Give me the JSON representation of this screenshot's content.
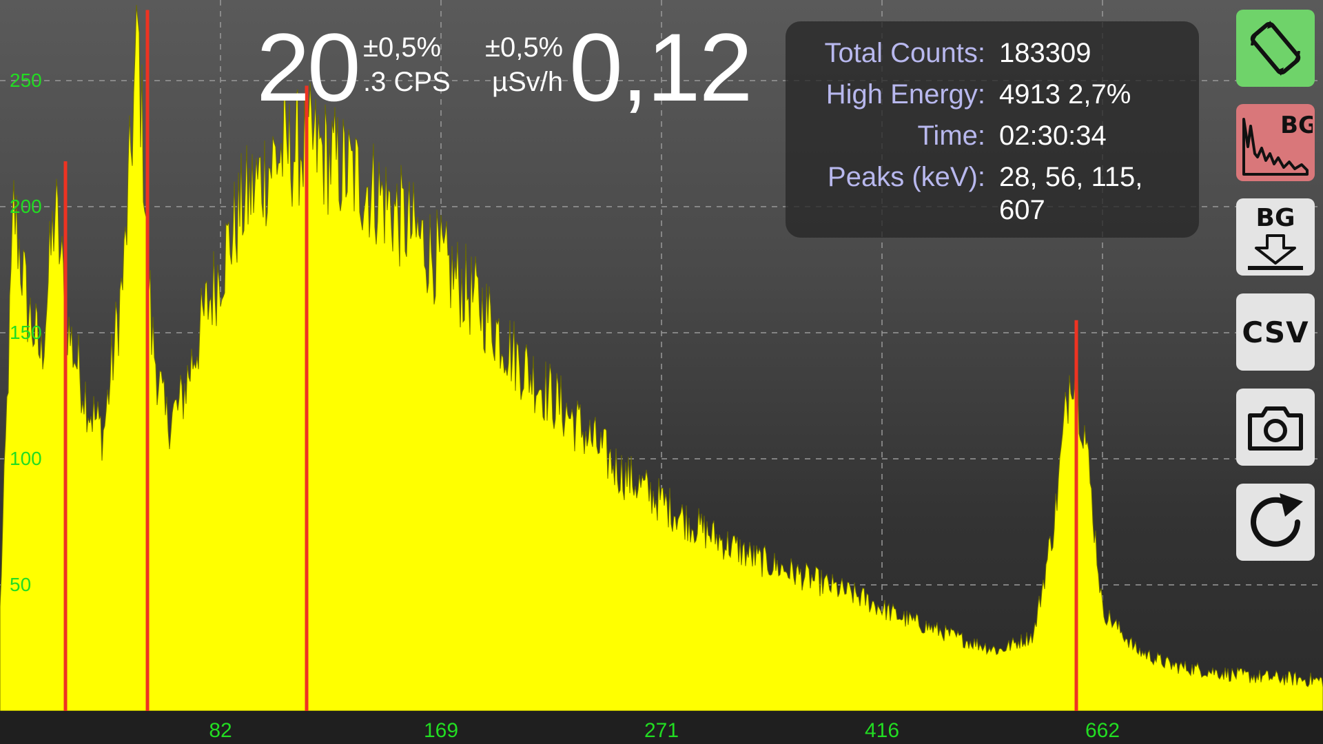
{
  "readings": {
    "cps_int": "20",
    "cps_error": "±0,5%",
    "cps_unit": ".3 CPS",
    "dose_error": "±0,5%",
    "dose_unit": "µSv/h",
    "dose_value": "0,12"
  },
  "info": {
    "total_counts_label": "Total Counts:",
    "total_counts_value": "183309",
    "high_energy_label": "High Energy:",
    "high_energy_value": "4913 2,7%",
    "time_label": "Time:",
    "time_value": "02:30:34",
    "peaks_label": "Peaks (keV):",
    "peaks_value": "28, 56, 115, 607"
  },
  "toolbar": {
    "rotate_icon": "screen-rotation-icon",
    "bg_spectrum_label": "BG",
    "bg_save_label": "BG",
    "csv_label": "CSV",
    "camera_icon": "camera-icon",
    "reset_icon": "refresh-icon",
    "colors": {
      "rotate_bg": "#6fd36a",
      "bg_spectrum_bg": "#d9777a",
      "default_bg": "#e4e4e4"
    }
  },
  "colors": {
    "spectrum_fill": "#ffff00",
    "peak_marker": "#ee3322",
    "axis_text": "#22dd22",
    "bottom_bar": "#1f1f1f"
  },
  "chart_data": {
    "type": "area",
    "yticks": [
      50,
      100,
      150,
      200,
      250
    ],
    "ylim": [
      0,
      280
    ],
    "xticks": [
      "82",
      "169",
      "271",
      "416",
      "662"
    ],
    "peak_markers": [
      28,
      56,
      115,
      607
    ],
    "grid": true,
    "envelope": [
      {
        "ch": 0,
        "v": 40
      },
      {
        "ch": 20,
        "v": 200
      },
      {
        "ch": 40,
        "v": 160
      },
      {
        "ch": 60,
        "v": 140
      },
      {
        "ch": 80,
        "v": 200
      },
      {
        "ch": 100,
        "v": 150
      },
      {
        "ch": 130,
        "v": 120
      },
      {
        "ch": 150,
        "v": 110
      },
      {
        "ch": 180,
        "v": 175
      },
      {
        "ch": 200,
        "v": 270
      },
      {
        "ch": 220,
        "v": 150
      },
      {
        "ch": 240,
        "v": 115
      },
      {
        "ch": 260,
        "v": 120
      },
      {
        "ch": 300,
        "v": 160
      },
      {
        "ch": 350,
        "v": 200
      },
      {
        "ch": 400,
        "v": 220
      },
      {
        "ch": 450,
        "v": 225
      },
      {
        "ch": 500,
        "v": 215
      },
      {
        "ch": 550,
        "v": 205
      },
      {
        "ch": 600,
        "v": 190
      },
      {
        "ch": 650,
        "v": 175
      },
      {
        "ch": 700,
        "v": 160
      },
      {
        "ch": 750,
        "v": 140
      },
      {
        "ch": 800,
        "v": 125
      },
      {
        "ch": 850,
        "v": 110
      },
      {
        "ch": 900,
        "v": 95
      },
      {
        "ch": 950,
        "v": 85
      },
      {
        "ch": 1000,
        "v": 75
      },
      {
        "ch": 1050,
        "v": 67
      },
      {
        "ch": 1100,
        "v": 60
      },
      {
        "ch": 1150,
        "v": 55
      },
      {
        "ch": 1200,
        "v": 50
      },
      {
        "ch": 1250,
        "v": 45
      },
      {
        "ch": 1300,
        "v": 38
      },
      {
        "ch": 1350,
        "v": 33
      },
      {
        "ch": 1400,
        "v": 28
      },
      {
        "ch": 1450,
        "v": 24
      },
      {
        "ch": 1500,
        "v": 30
      },
      {
        "ch": 1530,
        "v": 75
      },
      {
        "ch": 1555,
        "v": 140
      },
      {
        "ch": 1575,
        "v": 110
      },
      {
        "ch": 1600,
        "v": 40
      },
      {
        "ch": 1650,
        "v": 24
      },
      {
        "ch": 1700,
        "v": 18
      },
      {
        "ch": 1800,
        "v": 14
      },
      {
        "ch": 1920,
        "v": 12
      }
    ]
  }
}
